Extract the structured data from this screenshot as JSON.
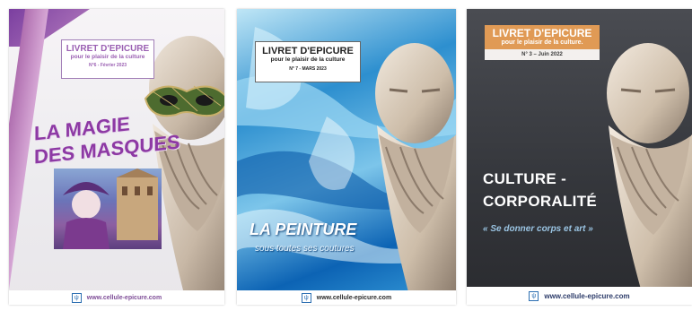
{
  "covers": [
    {
      "title": "LIVRET D'EPICURE",
      "subtitle": "pour le plaisir de la culture",
      "issue": "N°6 - Février 2023",
      "headline_line1": "LA MAGIE",
      "headline_line2": "DES MASQUES",
      "footer_url": "www.cellule-epicure.com",
      "accent_color": "#9a5fb2"
    },
    {
      "title": "LIVRET D'EPICURE",
      "subtitle": "pour le plaisir de la culture",
      "issue": "N° 7  -  MARS 2023",
      "headline_line1": "LA PEINTURE",
      "headline_line2": "sous toutes ses coutures",
      "footer_url": "www.cellule-epicure.com",
      "accent_color": "#1f7cc4"
    },
    {
      "title": "LIVRET D'EPICURE",
      "subtitle": "pour le plaisir de la culture.",
      "issue": "N° 3 – Juin 2022",
      "headline_line1": "CULTURE -",
      "headline_line2": "CORPORALITÉ",
      "quote": "« Se donner corps et art »",
      "footer_url": "www.cellule-epicure.com",
      "accent_color": "#e09a55"
    }
  ],
  "icons": {
    "footer_logo": "cellule-epicure-logo-icon",
    "bust": "epicurus-bust-icon",
    "mask": "venetian-mask-icon"
  }
}
